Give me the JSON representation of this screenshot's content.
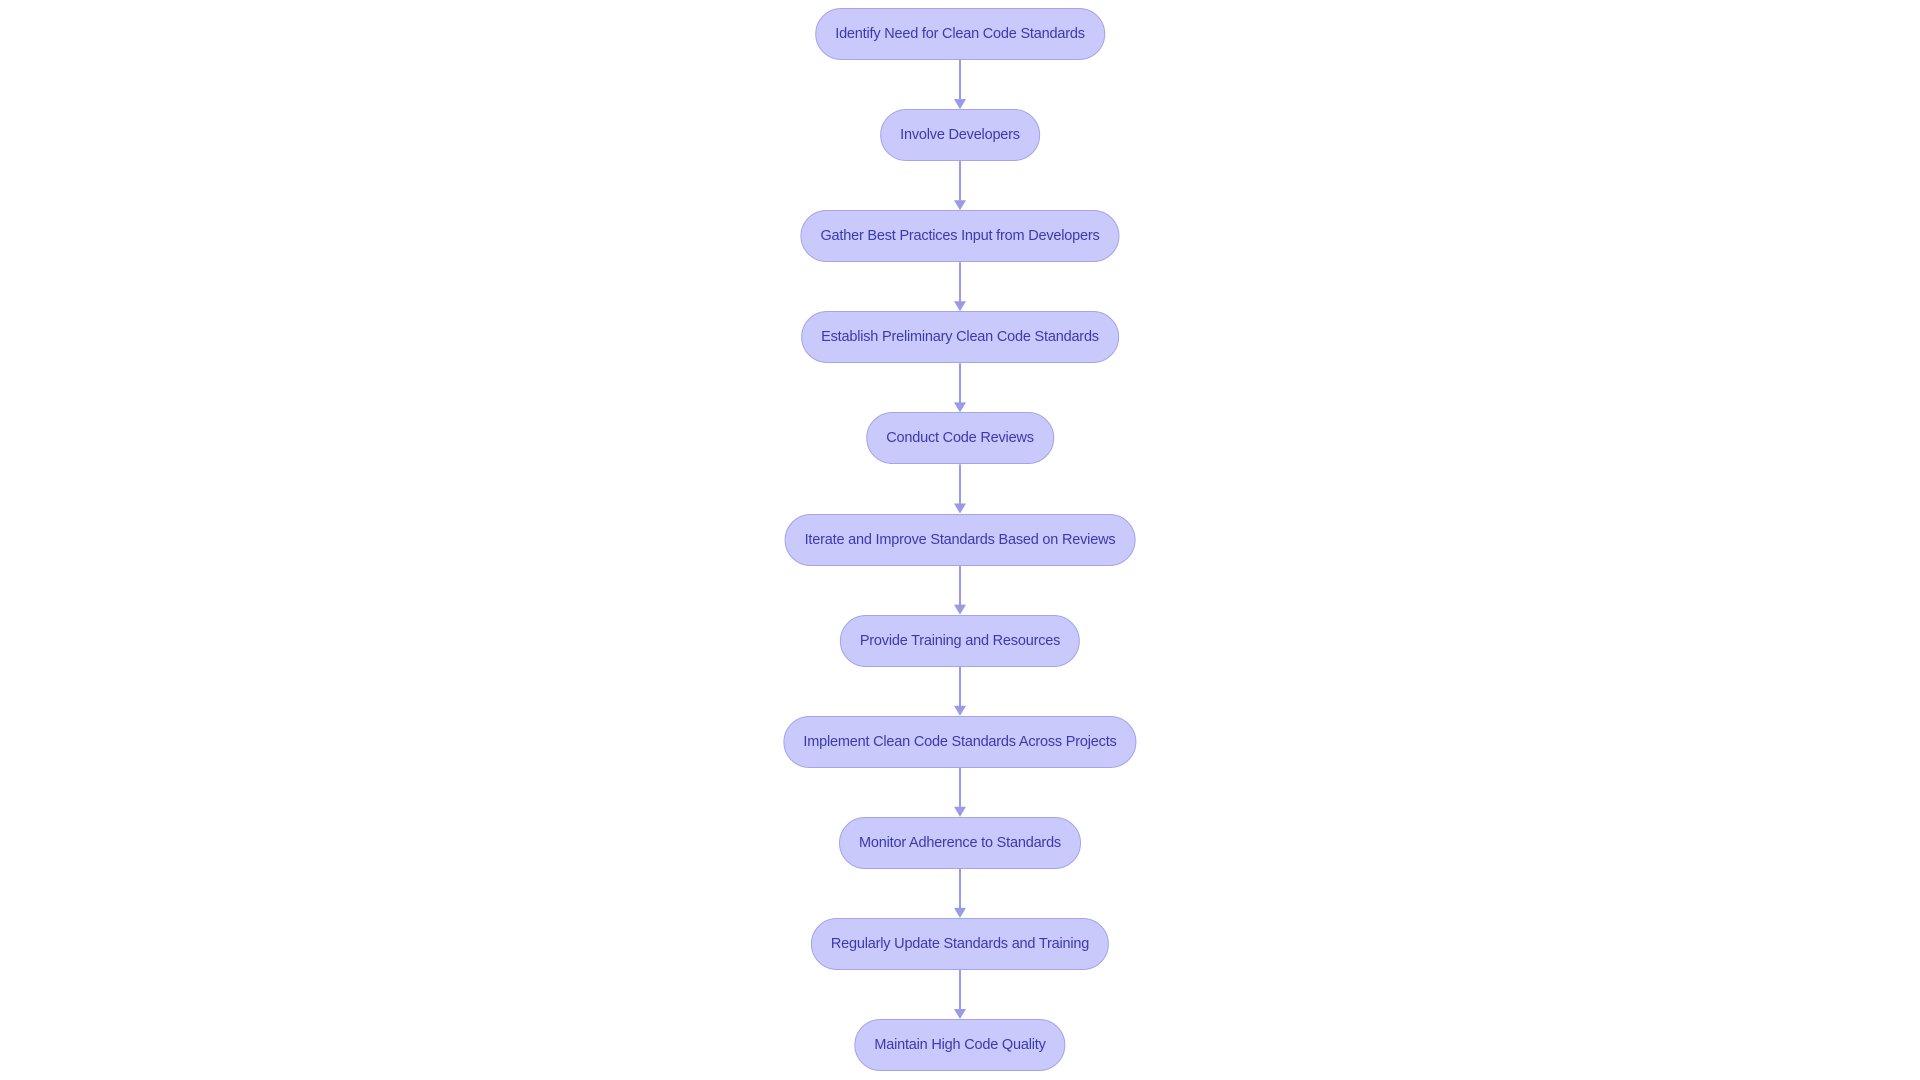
{
  "diagram": {
    "type": "flowchart",
    "direction": "top-down",
    "colors": {
      "node_fill": "#c9c9fb",
      "node_stroke": "#a3a3ee",
      "text": "#3a3ab0",
      "edge": "#9a9ae6"
    },
    "nodes": [
      {
        "label": "Identify Need for Clean Code Standards"
      },
      {
        "label": "Involve Developers"
      },
      {
        "label": "Gather Best Practices Input from Developers"
      },
      {
        "label": "Establish Preliminary Clean Code Standards"
      },
      {
        "label": "Conduct Code Reviews"
      },
      {
        "label": "Iterate and Improve Standards Based on Reviews"
      },
      {
        "label": "Provide Training and Resources"
      },
      {
        "label": "Implement Clean Code Standards Across Projects"
      },
      {
        "label": "Monitor Adherence to Standards"
      },
      {
        "label": "Regularly Update Standards and Training"
      },
      {
        "label": "Maintain High Code Quality"
      }
    ]
  }
}
